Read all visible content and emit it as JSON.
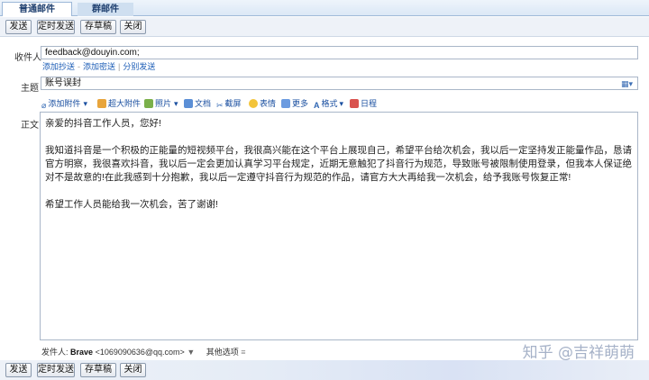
{
  "tabs": [
    {
      "label": "普通邮件",
      "active": true
    },
    {
      "label": "群邮件",
      "active": false
    }
  ],
  "toolbar": {
    "send": "发送",
    "scheduled_send": "定时发送",
    "save_draft": "存草稿",
    "close": "关闭"
  },
  "compose": {
    "recipient_label": "收件人",
    "recipient_value": "feedback@douyin.com;",
    "links": {
      "add_cc": "添加抄送",
      "add_bcc": "添加密送",
      "separate_send": "分别发送"
    },
    "subject_label": "主题",
    "subject_value": "账号误封",
    "body_label": "正文"
  },
  "format_toolbar": {
    "add_attachment": "添加附件",
    "large_attachment": "超大附件",
    "photo": "照片",
    "document": "文档",
    "screenshot": "截屏",
    "emoji": "表情",
    "more": "更多",
    "format": "格式",
    "calendar": "日程"
  },
  "body": {
    "greeting": "亲爱的抖音工作人员，您好!",
    "paragraph": "我知道抖音是一个积极的正能量的短视频平台，我很高兴能在这个平台上展现自己，希望平台给次机会，我以后一定坚持发正能量作品，恳请官方明察，我很喜欢抖音，我以后一定会更加认真学习平台规定，近期无意触犯了抖音行为规范，导致账号被限制使用登录，但我本人保证绝对不是故意的!在此我感到十分抱歉，我以后一定遵守抖音行为规范的作品，请官方大大再给我一次机会，给予我账号恢复正常!",
    "closing": "希望工作人员能给我一次机会，苦了谢谢!"
  },
  "footer": {
    "sender_label": "发件人:",
    "sender_name": "Brave",
    "sender_email": "<1069090636@qq.com>",
    "dropdown_arrow": "▼",
    "other_options": "其他选项",
    "options_arrow": "≡"
  },
  "watermark": "知乎 @吉祥萌萌",
  "colors": {
    "link": "#1a5bb5",
    "tab_text": "#1e3f6f",
    "border": "#a9b6c8"
  }
}
